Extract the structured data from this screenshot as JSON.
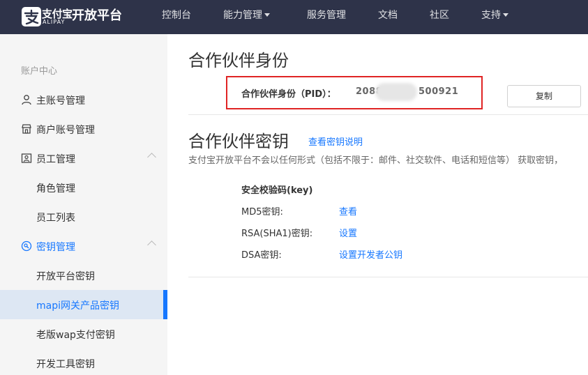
{
  "header": {
    "logo_cn": "支付宝",
    "logo_en": "ALIPAY",
    "brand": "开放平台",
    "nav": [
      {
        "label": "控制台"
      },
      {
        "label": "能力管理"
      },
      {
        "label": "服务管理"
      },
      {
        "label": "文档"
      },
      {
        "label": "社区"
      },
      {
        "label": "支持"
      }
    ]
  },
  "sidebar": {
    "heading": "账户中心",
    "items": [
      {
        "label": "主账号管理"
      },
      {
        "label": "商户账号管理"
      },
      {
        "label": "员工管理"
      },
      {
        "label": "角色管理"
      },
      {
        "label": "员工列表"
      },
      {
        "label": "密钥管理"
      },
      {
        "label": "开放平台密钥"
      },
      {
        "label": "mapi网关产品密钥"
      },
      {
        "label": "老版wap支付密钥"
      },
      {
        "label": "开发工具密钥"
      }
    ]
  },
  "main": {
    "identity_title": "合作伙伴身份",
    "pid_label": "合作伙伴身份（PID）：",
    "pid_prefix": "2088",
    "pid_suffix": "500921",
    "copy_label": "复制",
    "key_title": "合作伙伴密钥",
    "key_explain_link": "查看密钥说明",
    "description": "支付宝开放平台不会以任何形式（包括不限于：邮件、社交软件、电话和短信等） 获取密钥，",
    "security_title": "安全校验码(key)",
    "keys": [
      {
        "label": "MD5密钥:",
        "action": "查看"
      },
      {
        "label": "RSA(SHA1)密钥:",
        "action": "设置"
      },
      {
        "label": "DSA密钥:",
        "action": "设置开发者公钥"
      }
    ]
  }
}
